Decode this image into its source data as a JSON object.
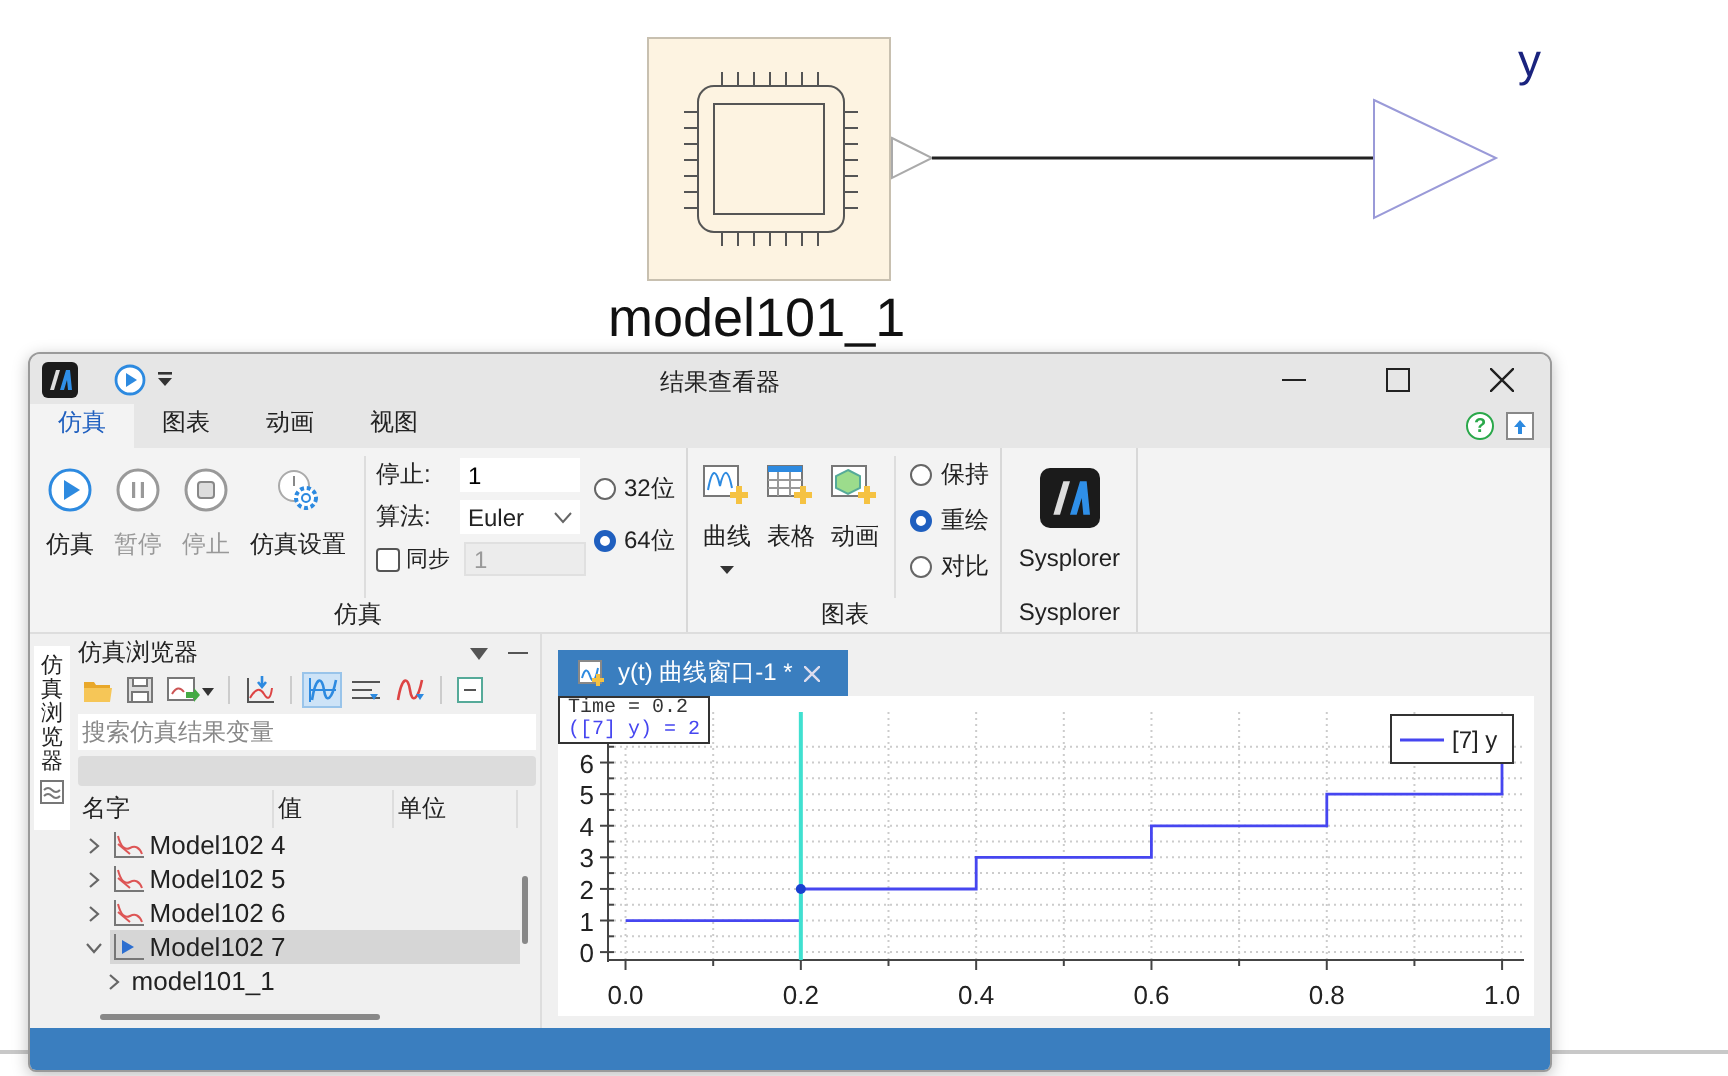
{
  "diagram": {
    "block_label": "model101_1",
    "output_label": "y"
  },
  "window": {
    "title": "结果查看器",
    "help": "?"
  },
  "ribbon_tabs": [
    {
      "label": "仿真",
      "selected": true
    },
    {
      "label": "图表",
      "selected": false
    },
    {
      "label": "动画",
      "selected": false
    },
    {
      "label": "视图",
      "selected": false
    }
  ],
  "sim_group": {
    "label": "仿真",
    "buttons": [
      {
        "label": "仿真",
        "kind": "play",
        "disabled": false
      },
      {
        "label": "暂停",
        "kind": "pause",
        "disabled": true
      },
      {
        "label": "停止",
        "kind": "stop",
        "disabled": true
      },
      {
        "label": "仿真设置",
        "kind": "settings",
        "disabled": false
      }
    ],
    "stop": {
      "label": "停止:",
      "value": "1"
    },
    "algorithm": {
      "label": "算法:",
      "value": "Euler"
    },
    "sync": {
      "label": "同步",
      "checked": false,
      "value": "1"
    },
    "bits": [
      {
        "label": "32位",
        "selected": false
      },
      {
        "label": "64位",
        "selected": true
      }
    ]
  },
  "chart_group": {
    "label": "图表",
    "buttons": [
      {
        "label": "曲线",
        "kind": "curve",
        "dropdown": true
      },
      {
        "label": "表格",
        "kind": "table",
        "dropdown": false
      },
      {
        "label": "动画",
        "kind": "animation",
        "dropdown": false
      }
    ],
    "modes": [
      {
        "label": "保持",
        "selected": false
      },
      {
        "label": "重绘",
        "selected": true
      },
      {
        "label": "对比",
        "selected": false
      }
    ]
  },
  "sysplorer_group": {
    "button": "Sysplorer",
    "label": "Sysplorer"
  },
  "side_tab": {
    "label": "仿真浏览器"
  },
  "browser": {
    "title": "仿真浏览器",
    "toolbar": [
      {
        "kind": "open",
        "selected": false
      },
      {
        "kind": "save",
        "selected": false
      },
      {
        "kind": "export",
        "selected": false
      },
      {
        "kind": "import",
        "selected": false
      },
      {
        "kind": "curve_sync",
        "selected": true
      },
      {
        "kind": "list",
        "selected": false
      },
      {
        "kind": "curve",
        "selected": false
      },
      {
        "kind": "collapse",
        "selected": false
      }
    ],
    "search": {
      "placeholder": "搜索仿真结果变量"
    },
    "columns": [
      "名字",
      "值",
      "单位"
    ],
    "tree": [
      {
        "name": "Model102 4",
        "kind": "result",
        "expanded": false,
        "selected": false
      },
      {
        "name": "Model102 5",
        "kind": "result",
        "expanded": false,
        "selected": false
      },
      {
        "name": "Model102 6",
        "kind": "result",
        "expanded": false,
        "selected": false
      },
      {
        "name": "Model102 7",
        "kind": "run",
        "expanded": true,
        "selected": true,
        "children": [
          {
            "name": "model101_1",
            "expanded": false,
            "selected": false
          }
        ]
      }
    ]
  },
  "plot_tab": {
    "label": "y(t) 曲线窗口-1 *"
  },
  "cursor_readout": [
    "Time = 0.2",
    "([7] y) = 2"
  ],
  "chart_data": {
    "type": "line",
    "x": [
      0,
      0.2,
      0.2,
      0.4,
      0.4,
      0.6,
      0.6,
      0.8,
      0.8,
      1.0,
      1.0
    ],
    "series": [
      {
        "name": "[7] y",
        "color": "#4646f0",
        "values": [
          1,
          1,
          2,
          2,
          3,
          3,
          4,
          4,
          5,
          5,
          6
        ]
      }
    ],
    "xlim": [
      -0.02,
      1.025
    ],
    "ylim": [
      -0.25,
      7.6
    ],
    "grid": true,
    "xticks": [
      {
        "value": 0,
        "label": "0.0"
      },
      {
        "value": 0.2,
        "label": "0.2"
      },
      {
        "value": 0.4,
        "label": "0.4"
      },
      {
        "value": 0.6,
        "label": "0.6"
      },
      {
        "value": 0.8,
        "label": "0.8"
      },
      {
        "value": 1,
        "label": "1.0"
      }
    ],
    "yticks": [
      0,
      1,
      2,
      3,
      4,
      5,
      6
    ],
    "ref_lines": [
      {
        "axis": "x",
        "value": 0.2,
        "color": "#40e0d0"
      }
    ]
  }
}
